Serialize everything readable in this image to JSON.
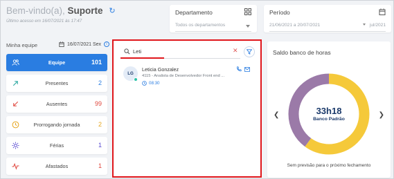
{
  "header": {
    "welcome_prefix": "Bem-vindo(a),",
    "user_name": "Suporte",
    "last_access": "Último acesso em 16/07/2021 às 17:47"
  },
  "filters": {
    "department": {
      "label": "Departamento",
      "value": "Todos os departamentos"
    },
    "period": {
      "label": "Período",
      "value": "21/06/2021 a 20/07/2021",
      "month": "jul/2021"
    }
  },
  "team": {
    "heading": "Minha equipe",
    "date": "16/07/2021 Sex",
    "stats": [
      {
        "label": "Equipe",
        "count": "101",
        "icon": "team-icon",
        "color": "#ffffff",
        "active": true
      },
      {
        "label": "Presentes",
        "count": "2",
        "icon": "arrow-up-right-icon",
        "color": "#2aa7a0"
      },
      {
        "label": "Ausentes",
        "count": "99",
        "icon": "arrow-down-left-icon",
        "color": "#e0483f"
      },
      {
        "label": "Prorrogando jornada",
        "count": "2",
        "icon": "clock-icon",
        "color": "#e6a51c"
      },
      {
        "label": "Férias",
        "count": "1",
        "icon": "sun-icon",
        "color": "#5a4bd1"
      },
      {
        "label": "Afastados",
        "count": "1",
        "icon": "pulse-icon",
        "color": "#e0483f"
      }
    ]
  },
  "search": {
    "query": "Leti",
    "result": {
      "initials": "LG",
      "name": "Leticia Gonzalez",
      "role": "4115 - Analista de Desenvolvedor Front end ...",
      "time": "08:30"
    }
  },
  "saldo": {
    "title": "Saldo banco de horas",
    "value": "33h18",
    "bank": "Banco Padrão",
    "footer": "Sem previsão para o próximo fechamento",
    "segments": [
      {
        "name": "positive",
        "fraction": 0.6,
        "color": "#f5c93a"
      },
      {
        "name": "negative",
        "fraction": 0.4,
        "color": "#9b7aa8"
      }
    ]
  },
  "colors": {
    "accent": "#2a7de1",
    "highlight": "#e0161b"
  }
}
